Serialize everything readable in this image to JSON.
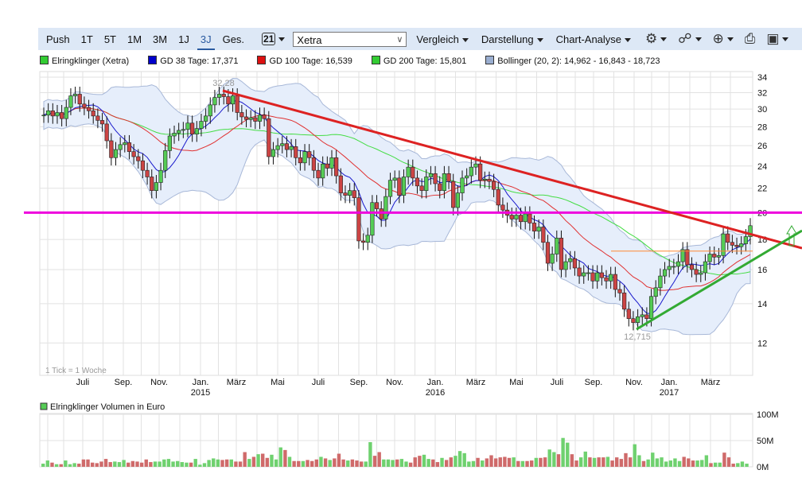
{
  "toolbar": {
    "periods": [
      "Push",
      "1T",
      "5T",
      "1M",
      "3M",
      "1J",
      "3J",
      "Ges."
    ],
    "active_period": "3J",
    "calendar_icon": "calendar-icon",
    "calendar_day": "21",
    "exchange": "Xetra",
    "menus": [
      "Vergleich",
      "Darstellung",
      "Chart-Analyse"
    ],
    "icons": [
      "gear-icon",
      "network-icon",
      "zoom-in-icon",
      "print-icon",
      "save-icon"
    ]
  },
  "legend": [
    {
      "label": "Elringklinger (Xetra)",
      "color": "#33cc33"
    },
    {
      "label": "GD 38 Tage: 17,371",
      "color": "#0000cc"
    },
    {
      "label": "GD 100 Tage: 16,539",
      "color": "#dd1111"
    },
    {
      "label": "GD 200 Tage: 15,801",
      "color": "#33cc33"
    },
    {
      "label": "Bollinger (20, 2): 14,962 - 16,843 - 18,723",
      "color": "#9aaed0"
    }
  ],
  "colors": {
    "up": "#55cc55",
    "down": "#cc4444",
    "ma38": "#1a1acc",
    "ma100": "#e03030",
    "ma200": "#44dd44",
    "band": "#e6eefb",
    "band_edge": "#a8b8d8",
    "resistance": "#dd2222",
    "support": "#33aa33",
    "horizontal": "#ee00dd",
    "level": "#ff8833"
  },
  "chart_data": {
    "type": "candlestick",
    "interval_note": "1 Tick = 1 Woche",
    "y_scale": "log",
    "ylim": [
      10.5,
      35
    ],
    "y_ticks": [
      "34",
      "32",
      "30",
      "28",
      "26",
      "24",
      "22",
      "20",
      "18",
      "16",
      "14",
      "12"
    ],
    "x_ticks": [
      {
        "label": "Juli",
        "year": ""
      },
      {
        "label": "Sep.",
        "year": ""
      },
      {
        "label": "Nov.",
        "year": ""
      },
      {
        "label": "Jan.",
        "year": "2015"
      },
      {
        "label": "März",
        "year": ""
      },
      {
        "label": "Mai",
        "year": ""
      },
      {
        "label": "Juli",
        "year": ""
      },
      {
        "label": "Sep.",
        "year": ""
      },
      {
        "label": "Nov.",
        "year": ""
      },
      {
        "label": "Jan.",
        "year": "2016"
      },
      {
        "label": "März",
        "year": ""
      },
      {
        "label": "Mai",
        "year": ""
      },
      {
        "label": "Juli",
        "year": ""
      },
      {
        "label": "Sep.",
        "year": ""
      },
      {
        "label": "Nov.",
        "year": ""
      },
      {
        "label": "Jan.",
        "year": "2017"
      },
      {
        "label": "März",
        "year": ""
      }
    ],
    "weekly_close": [
      29.3,
      29.8,
      29.2,
      29.6,
      28.9,
      30.2,
      31.6,
      31.8,
      30.6,
      30.2,
      29.8,
      29.2,
      28.7,
      28.3,
      26.5,
      24.8,
      25.6,
      26.1,
      26.3,
      25.4,
      24.9,
      24.5,
      23.6,
      23.0,
      21.8,
      22.5,
      23.6,
      25.5,
      27.0,
      27.3,
      27.6,
      27.7,
      28.4,
      27.2,
      27.8,
      28.6,
      29.2,
      30.5,
      31.4,
      31.8,
      31.5,
      30.6,
      31.6,
      29.6,
      29.1,
      28.8,
      29.0,
      28.6,
      29.3,
      28.9,
      24.9,
      25.6,
      26.0,
      26.2,
      25.6,
      25.9,
      24.8,
      24.3,
      25.4,
      24.8,
      23.6,
      22.9,
      24.2,
      23.8,
      24.8,
      23.1,
      21.6,
      21.4,
      21.8,
      21.2,
      17.9,
      17.8,
      18.3,
      20.8,
      20.3,
      19.5,
      21.3,
      22.7,
      22.9,
      21.4,
      23.0,
      23.9,
      22.9,
      22.2,
      21.8,
      23.0,
      23.3,
      22.4,
      21.8,
      23.3,
      22.6,
      20.4,
      21.6,
      22.9,
      23.1,
      23.9,
      24.2,
      22.7,
      22.8,
      22.6,
      21.9,
      20.6,
      20.2,
      19.8,
      19.5,
      19.8,
      19.3,
      19.9,
      19.2,
      18.6,
      18.9,
      17.8,
      16.4,
      17.0,
      18.1,
      16.0,
      16.5,
      16.7,
      16.1,
      15.6,
      15.8,
      15.8,
      15.3,
      15.8,
      15.5,
      15.3,
      15.7,
      14.8,
      14.6,
      13.7,
      13.2,
      13.0,
      13.3,
      13.4,
      13.2,
      14.4,
      14.9,
      15.6,
      16.0,
      16.2,
      16.2,
      16.5,
      17.3,
      16.3,
      16.0,
      15.7,
      15.8,
      16.5,
      17.0,
      16.8,
      16.9,
      18.4,
      17.8,
      17.6,
      17.5,
      17.7,
      18.2,
      19.0
    ],
    "annotations": {
      "high": "32,28",
      "low": "12,715"
    },
    "horizontal_line": 20,
    "level_line": 17.2,
    "moving_averages": [
      38,
      100,
      200
    ],
    "bollinger": [
      20,
      2
    ],
    "volume": {
      "title": "Elringklinger Volumen in Euro",
      "unit": "M",
      "y_ticks": [
        "100M",
        "50M",
        "0M"
      ],
      "ylim": [
        0,
        100
      ],
      "values": [
        6,
        12,
        8,
        5,
        5,
        12,
        5,
        7,
        6,
        14,
        14,
        8,
        7,
        10,
        15,
        9,
        10,
        9,
        13,
        8,
        11,
        10,
        8,
        14,
        9,
        10,
        10,
        14,
        15,
        10,
        11,
        9,
        8,
        8,
        15,
        4,
        7,
        13,
        16,
        14,
        13,
        14,
        14,
        10,
        10,
        28,
        15,
        19,
        24,
        25,
        17,
        23,
        14,
        37,
        32,
        19,
        11,
        11,
        11,
        13,
        11,
        14,
        19,
        16,
        13,
        16,
        25,
        14,
        12,
        14,
        12,
        10,
        10,
        47,
        21,
        28,
        14,
        14,
        13,
        14,
        15,
        10,
        8,
        18,
        21,
        23,
        15,
        14,
        9,
        17,
        13,
        18,
        21,
        30,
        26,
        10,
        11,
        17,
        12,
        16,
        22,
        16,
        18,
        19,
        17,
        18,
        11,
        11,
        11,
        12,
        17,
        17,
        18,
        33,
        28,
        24,
        55,
        46,
        24,
        12,
        18,
        29,
        18,
        17,
        18,
        18,
        19,
        12,
        18,
        15,
        26,
        18,
        43,
        22,
        11,
        14,
        27,
        16,
        18,
        10,
        12,
        16,
        11,
        19,
        16,
        12,
        12,
        13,
        22,
        7,
        8,
        8,
        27,
        18,
        6,
        7,
        10,
        6
      ]
    }
  }
}
